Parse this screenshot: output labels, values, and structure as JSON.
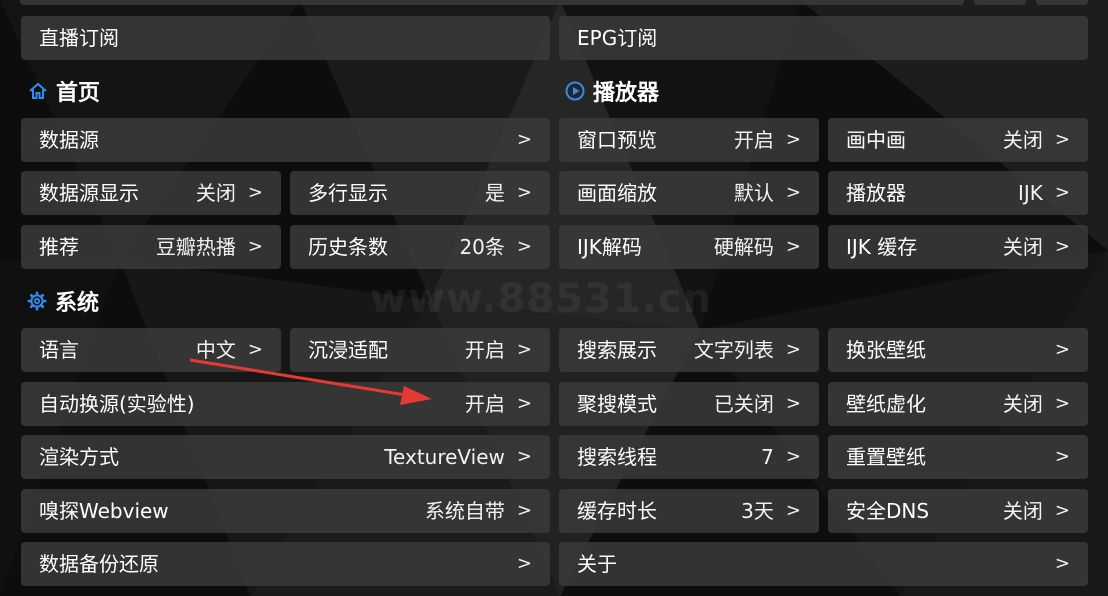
{
  "colors": {
    "accent": "#2f8cf0",
    "annotation_arrow": "#e53935",
    "card_bg": "#3a3a3a"
  },
  "top": {
    "live_subscription": "直播订阅",
    "epg_subscription": "EPG订阅"
  },
  "sections": {
    "home": {
      "title": "首页",
      "icon": "home-icon"
    },
    "player": {
      "title": "播放器",
      "icon": "play-circle-icon"
    },
    "system": {
      "title": "系统",
      "icon": "gear-icon"
    }
  },
  "home": {
    "data_source": {
      "label": "数据源",
      "value": ""
    },
    "data_source_display": {
      "label": "数据源显示",
      "value": "关闭"
    },
    "multiline_display": {
      "label": "多行显示",
      "value": "是"
    },
    "recommend": {
      "label": "推荐",
      "value": "豆瓣热播"
    },
    "history_count": {
      "label": "历史条数",
      "value": "20条"
    }
  },
  "player": {
    "window_preview": {
      "label": "窗口预览",
      "value": "开启"
    },
    "pip": {
      "label": "画中画",
      "value": "关闭"
    },
    "scale": {
      "label": "画面缩放",
      "value": "默认"
    },
    "player": {
      "label": "播放器",
      "value": "IJK"
    },
    "ijk_decode": {
      "label": "IJK解码",
      "value": "硬解码"
    },
    "ijk_cache": {
      "label": "IJK 缓存",
      "value": "关闭"
    }
  },
  "system": {
    "language": {
      "label": "语言",
      "value": "中文"
    },
    "immersive": {
      "label": "沉浸适配",
      "value": "开启"
    },
    "auto_switch": {
      "label": "自动换源(实验性)",
      "value": "开启"
    },
    "render_mode": {
      "label": "渲染方式",
      "value": "TextureView"
    },
    "sniff_webview": {
      "label": "嗅探Webview",
      "value": "系统自带"
    },
    "backup_restore": {
      "label": "数据备份还原",
      "value": ""
    },
    "search_display": {
      "label": "搜索展示",
      "value": "文字列表"
    },
    "change_wallpaper": {
      "label": "换张壁纸",
      "value": ""
    },
    "aggregate_search": {
      "label": "聚搜模式",
      "value": "已关闭"
    },
    "wallpaper_blur": {
      "label": "壁纸虚化",
      "value": "关闭"
    },
    "search_threads": {
      "label": "搜索线程",
      "value": "7"
    },
    "reset_wallpaper": {
      "label": "重置壁纸",
      "value": ""
    },
    "cache_duration": {
      "label": "缓存时长",
      "value": "3天"
    },
    "secure_dns": {
      "label": "安全DNS",
      "value": "关闭"
    },
    "about": {
      "label": "关于",
      "value": ""
    }
  },
  "chevron": ">",
  "watermark": "www.88531.cn"
}
